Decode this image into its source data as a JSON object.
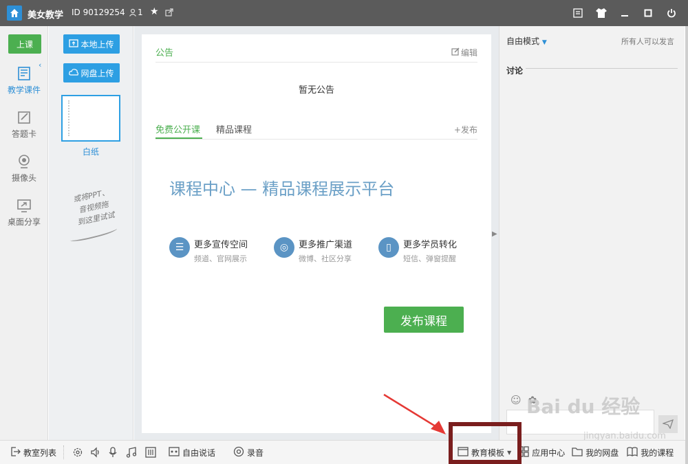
{
  "titlebar": {
    "app_name": "美女教学",
    "room_id": "ID 90129254",
    "user_count": "1"
  },
  "leftnav": {
    "class_button": "上课",
    "items": [
      {
        "label": "教学课件",
        "icon": "courseware-icon"
      },
      {
        "label": "答题卡",
        "icon": "answer-card-icon"
      },
      {
        "label": "摄像头",
        "icon": "camera-icon"
      },
      {
        "label": "桌面分享",
        "icon": "screen-share-icon"
      }
    ]
  },
  "filepanel": {
    "local_upload": "本地上传",
    "cloud_upload": "网盘上传",
    "thumb_label": "白纸",
    "hint_lines": [
      "或将PPT、",
      "音视频拖",
      "到这里试试"
    ]
  },
  "notice": {
    "title": "公告",
    "edit": "编辑",
    "empty": "暂无公告"
  },
  "tabs": [
    {
      "label": "免费公开课",
      "active": true
    },
    {
      "label": "精品课程",
      "active": false
    }
  ],
  "publish_link": "发布",
  "promo": {
    "title": "课程中心 — 精品课程展示平台",
    "features": [
      {
        "title": "更多宣传空间",
        "sub": "频道、官网展示",
        "icon": "list-icon"
      },
      {
        "title": "更多推广渠道",
        "sub": "微博、社区分享",
        "icon": "weibo-icon"
      },
      {
        "title": "更多学员转化",
        "sub": "短信、弹窗提醒",
        "icon": "phone-icon"
      }
    ],
    "publish_button": "发布课程"
  },
  "rightpanel": {
    "mode": "自由模式",
    "mode_desc": "所有人可以发言",
    "discuss": "讨论"
  },
  "bottombar": {
    "room_list": "教室列表",
    "free_talk": "自由说话",
    "record": "录音",
    "edu_template": "教育模板",
    "app_center": "应用中心",
    "my_cloud": "我的网盘",
    "my_courses": "我的课程"
  },
  "watermark": {
    "brand": "Bai du 经验",
    "url": "jingyan.baidu.com"
  },
  "colors": {
    "accent_green": "#4caf50",
    "accent_blue": "#2d9fe3",
    "annotation_red": "#e53935",
    "annotation_box": "#7a1e1e"
  }
}
